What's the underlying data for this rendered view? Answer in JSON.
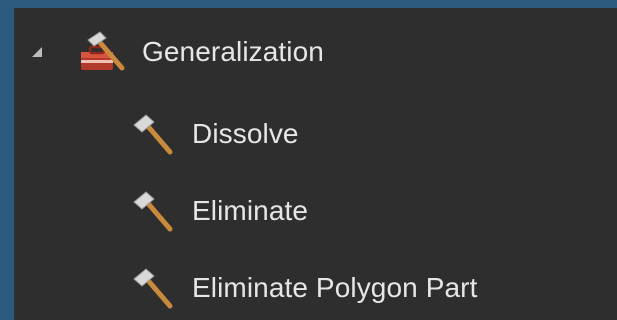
{
  "tree": {
    "group": {
      "label": "Generalization",
      "expanded": true,
      "icon": "toolbox-icon"
    },
    "tools": [
      {
        "label": "Dissolve",
        "icon": "hammer-icon"
      },
      {
        "label": "Eliminate",
        "icon": "hammer-icon"
      },
      {
        "label": "Eliminate Polygon Part",
        "icon": "hammer-icon"
      }
    ]
  },
  "colors": {
    "background": "#2b5a7e",
    "panel": "#2e2e2e",
    "text": "#e6e6e6",
    "toolbox_red": "#c0392b",
    "hammer_handle": "#c98a3d",
    "hammer_head": "#d9d9d9"
  }
}
